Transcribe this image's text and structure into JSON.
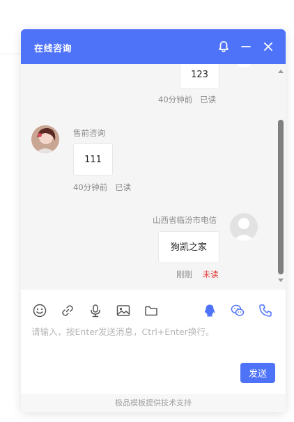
{
  "header": {
    "title": "在线咨询"
  },
  "messages": [
    {
      "side": "right",
      "text": "123",
      "time": "40分钟前",
      "status": "已读"
    },
    {
      "side": "left",
      "sender": "售前咨询",
      "text": "111",
      "time": "40分钟前",
      "status": "已读"
    },
    {
      "side": "right",
      "sender": "山西省临汾市电信",
      "text": "狗凯之家",
      "time": "刚刚",
      "status": "未读"
    }
  ],
  "input": {
    "placeholder": "请输入，按Enter发送消息，Ctrl+Enter换行。"
  },
  "send_label": "发送",
  "footer": "极品模板提供技术支持",
  "colors": {
    "accent": "#4f73f8",
    "unread": "#e53935"
  }
}
